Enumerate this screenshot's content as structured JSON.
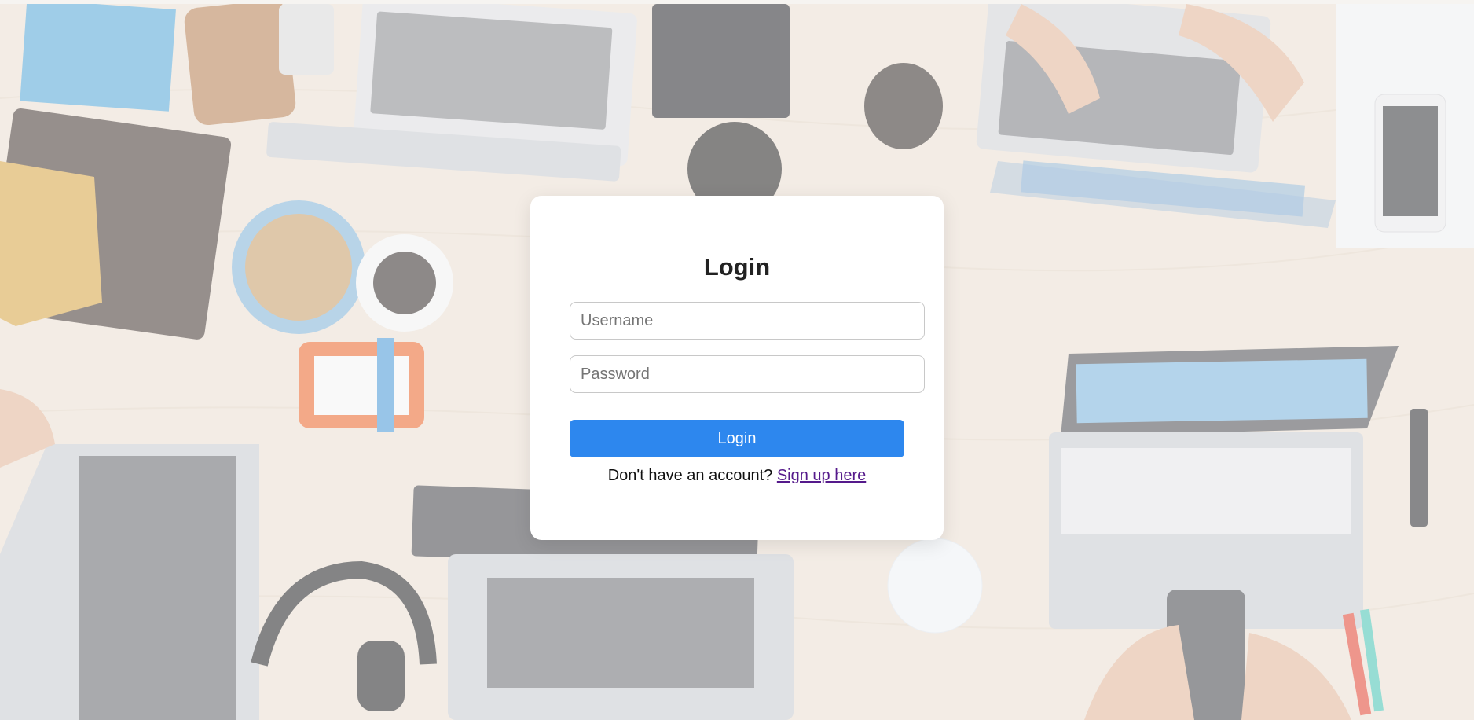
{
  "login": {
    "title": "Login",
    "username_placeholder": "Username",
    "password_placeholder": "Password",
    "submit_label": "Login",
    "signup_prompt": "Don't have an account?",
    "signup_link": "Sign up here"
  },
  "colors": {
    "primary_button": "#2d87ee",
    "link_visited": "#551a8b",
    "card_background": "#ffffff"
  }
}
